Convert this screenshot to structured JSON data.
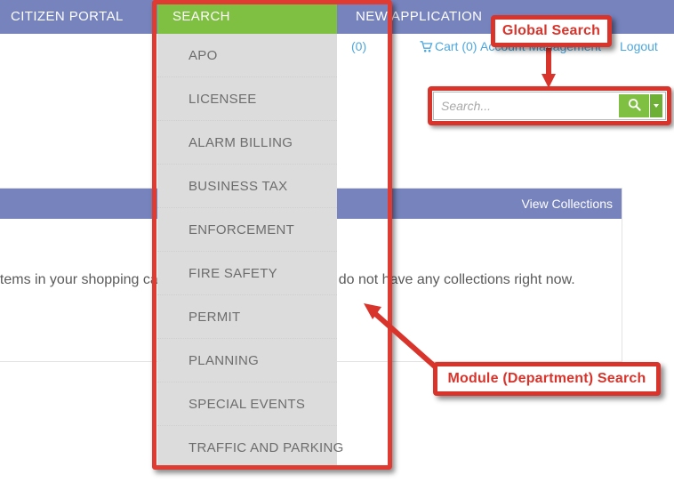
{
  "topnav": {
    "items": [
      {
        "label": "CITIZEN PORTAL",
        "name": "citizen-portal"
      },
      {
        "label": "SEARCH",
        "name": "search"
      },
      {
        "label": "NEW APPLICATION",
        "name": "new-application"
      }
    ],
    "citizen_label": "CITIZEN PORTAL",
    "search_label": "SEARCH",
    "newapp_label": "NEW APPLICATION",
    "active": "SEARCH",
    "bg_color": "#7683bd",
    "active_color": "#7fc043"
  },
  "utility_bar": {
    "collections_label": "(0)",
    "cart_label": "Cart (0)",
    "account_label": "Account Management",
    "logout_label": "Logout",
    "cart_icon": "shopping-cart-icon",
    "link_color": "#4ca7de"
  },
  "search_menu": {
    "name": "module-department-search-menu",
    "items": [
      "APO",
      "LICENSEE",
      "ALARM BILLING",
      "BUSINESS TAX",
      "ENFORCEMENT",
      "FIRE SAFETY",
      "PERMIT",
      "PLANNING",
      "SPECIAL EVENTS",
      "TRAFFIC AND PARKING"
    ],
    "bg_color": "#dcdcdc",
    "text_color": "#6d6d6d"
  },
  "global_search": {
    "placeholder": "Search...",
    "value": "",
    "button_icon": "magnifier-icon",
    "caret_icon": "chevron-down-icon",
    "button_color": "#7fc043"
  },
  "cart_panel": {
    "header_link": "",
    "message": "You have no items in your shopping cart right now."
  },
  "collections_panel": {
    "header_link": "View Collections",
    "message": "You do not have any collections right now."
  },
  "annotations": {
    "global_search_label": "Global Search",
    "module_search_label": "Module (Department) Search",
    "accent_color": "#d8342b"
  }
}
